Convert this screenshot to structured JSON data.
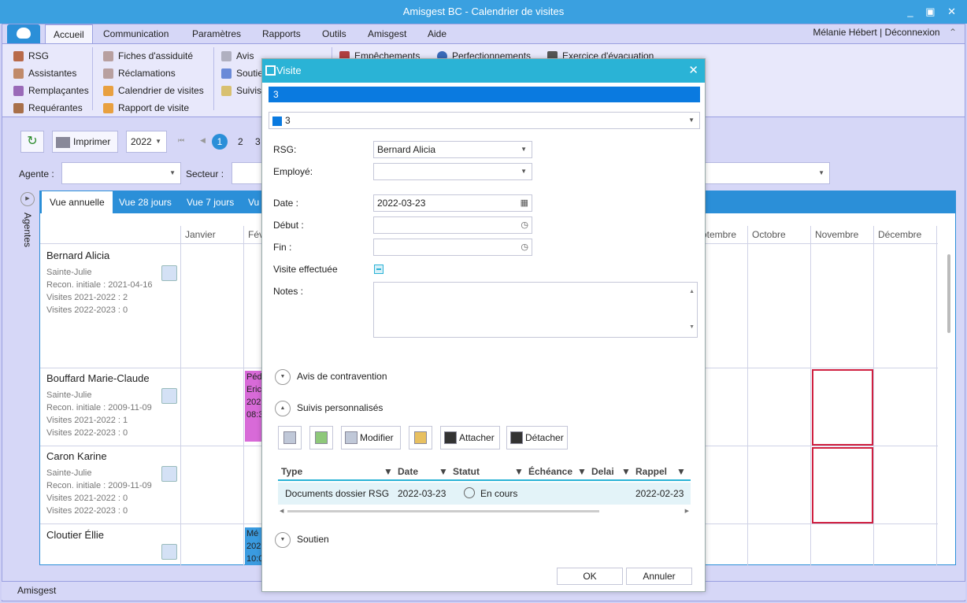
{
  "window": {
    "title": "Amisgest BC - Calendrier de visites",
    "controls": "_ ▣ ✕"
  },
  "ribbon": {
    "tabs": [
      "Accueil",
      "Communication",
      "Paramètres",
      "Rapports",
      "Outils",
      "Amisgest",
      "Aide"
    ],
    "user": "Mélanie Hébert",
    "separator": "|",
    "logout": "Déconnexion",
    "col1": [
      "RSG",
      "Assistantes",
      "Remplaçantes",
      "Requérantes"
    ],
    "col2": [
      "Fiches d'assiduité",
      "Réclamations",
      "Calendrier de visites",
      "Rapport de visite"
    ],
    "col3": [
      "Avis",
      "Soutie",
      "Suivis"
    ],
    "col4": [
      "Empêchements",
      "Perfectionnements",
      "Exercice d'évacuation"
    ]
  },
  "toolbar": {
    "print_label": "Imprimer",
    "year": "2022",
    "pages": [
      "1",
      "2",
      "3"
    ],
    "agente_label": "Agente :",
    "secteur_label": "Secteur :"
  },
  "side": {
    "agentes_label": "Agentes"
  },
  "views": [
    "Vue annuelle",
    "Vue 28 jours",
    "Vue 7 jours",
    "Vu"
  ],
  "months": {
    "janvier": "Janvier",
    "fevrier": "Févr",
    "septembre": "otembre",
    "octobre": "Octobre",
    "novembre": "Novembre",
    "decembre": "Décembre"
  },
  "agents": [
    {
      "name": "Bernard Alicia",
      "city": "Sainte-Julie",
      "recon": "Recon. initiale : 2021-04-16",
      "v1": "Visites 2021-2022 : 2",
      "v2": "Visites 2022-2023 : 0"
    },
    {
      "name": "Bouffard Marie-Claude",
      "city": "Sainte-Julie",
      "recon": "Recon. initiale : 2009-11-09",
      "v1": "Visites 2021-2022 : 1",
      "v2": "Visites 2022-2023 : 0"
    },
    {
      "name": "Caron Karine",
      "city": "Sainte-Julie",
      "recon": "Recon. initiale : 2009-11-09",
      "v1": "Visites 2021-2022 : 0",
      "v2": "Visites 2022-2023 : 0"
    },
    {
      "name": "Cloutier Éllie",
      "city": "",
      "recon": "",
      "v1": "",
      "v2": ""
    }
  ],
  "events": [
    {
      "l1": "Péd",
      "l2": "Eric",
      "l3": "202",
      "l4": "08:3",
      "color": "#d86ad8"
    },
    {
      "l1": "Mé",
      "l2": "202",
      "l3": "10:0",
      "color": "#3a9be0"
    }
  ],
  "status_bar": {
    "label": "Amisgest"
  },
  "dialog": {
    "title": "Visite",
    "close": "✕",
    "header_value": "3",
    "type_value": "3",
    "rsg_label": "RSG:",
    "rsg_value": "Bernard Alicia",
    "employe_label": "Employé:",
    "employe_value": "",
    "date_label": "Date :",
    "date_value": "2022-03-23",
    "debut_label": "Début :",
    "fin_label": "Fin :",
    "visite_label": "Visite effectuée",
    "notes_label": "Notes :",
    "sec_avis": "Avis de contravention",
    "sec_suivis": "Suivis personnalisés",
    "sec_soutien": "Soutien",
    "btn_modifier": "Modifier",
    "btn_attacher": "Attacher",
    "btn_detacher": "Détacher",
    "grid_headers": [
      "Type",
      "Date",
      "Statut",
      "Échéance",
      "Delai",
      "Rappel"
    ],
    "grid_row": {
      "type": "Documents dossier RSG",
      "date": "2022-03-23",
      "statut": "En cours",
      "rappel": "2022-02-23"
    },
    "ok": "OK",
    "cancel": "Annuler"
  }
}
